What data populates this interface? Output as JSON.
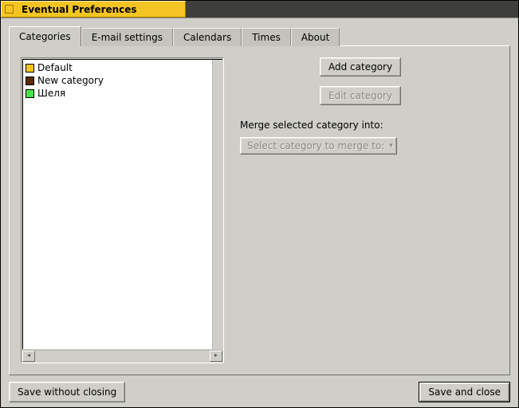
{
  "window": {
    "title": "Eventual Preferences"
  },
  "tabs": [
    {
      "label": "Categories",
      "active": true
    },
    {
      "label": "E-mail settings",
      "active": false
    },
    {
      "label": "Calendars",
      "active": false
    },
    {
      "label": "Times",
      "active": false
    },
    {
      "label": "About",
      "active": false
    }
  ],
  "categories": [
    {
      "name": "Default",
      "color": "#f4c522"
    },
    {
      "name": "New category",
      "color": "#5b2a00"
    },
    {
      "name": "Шеля",
      "color": "#4be24b"
    }
  ],
  "buttons": {
    "add_category": "Add category",
    "edit_category": "Edit category",
    "save_without_closing": "Save without closing",
    "save_and_close": "Save and close"
  },
  "merge": {
    "label": "Merge selected category into:",
    "placeholder": "Select category to merge to:"
  }
}
